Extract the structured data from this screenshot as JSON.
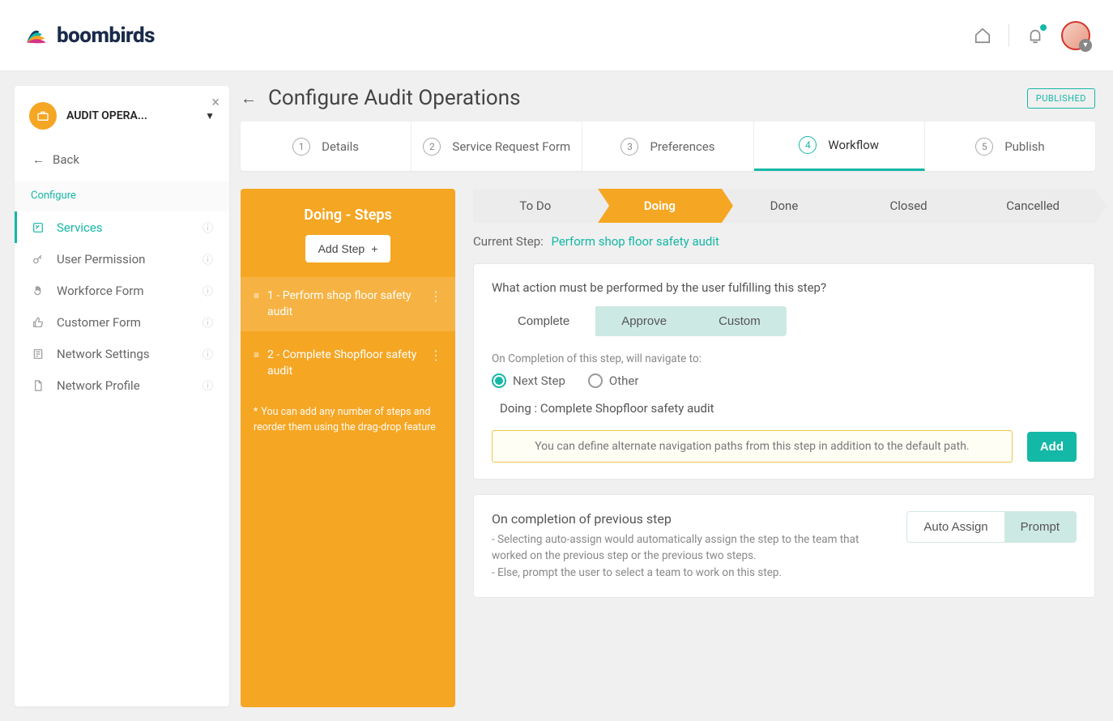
{
  "brand": "boombirds",
  "page": {
    "title": "Configure Audit Operations",
    "badge": "PUBLISHED"
  },
  "sidebar": {
    "header": "AUDIT OPERA...",
    "back": "Back",
    "section": "Configure",
    "items": [
      {
        "label": "Services",
        "active": true
      },
      {
        "label": "User Permission",
        "active": false
      },
      {
        "label": "Workforce Form",
        "active": false
      },
      {
        "label": "Customer Form",
        "active": false
      },
      {
        "label": "Network Settings",
        "active": false
      },
      {
        "label": "Network Profile",
        "active": false
      }
    ]
  },
  "tabs": [
    {
      "num": "1",
      "label": "Details"
    },
    {
      "num": "2",
      "label": "Service Request Form"
    },
    {
      "num": "3",
      "label": "Preferences"
    },
    {
      "num": "4",
      "label": "Workflow"
    },
    {
      "num": "5",
      "label": "Publish"
    }
  ],
  "steps_panel": {
    "title": "Doing - Steps",
    "add_button": "Add Step",
    "steps": [
      {
        "label": "1 - Perform shop floor safety audit"
      },
      {
        "label": "2 - Complete Shopfloor safety audit"
      }
    ],
    "hint": "You can add any number of steps and reorder them using the drag-drop feature"
  },
  "stages": [
    {
      "label": "To Do"
    },
    {
      "label": "Doing"
    },
    {
      "label": "Done"
    },
    {
      "label": "Closed"
    },
    {
      "label": "Cancelled"
    }
  ],
  "current_step": {
    "prefix": "Current Step:",
    "name": "Perform shop floor safety audit"
  },
  "action_card": {
    "question": "What action must be performed by the user fulfilling this step?",
    "options": {
      "complete": "Complete",
      "approve": "Approve",
      "custom": "Custom"
    },
    "completion_label": "On Completion of this step, will navigate to:",
    "radio": {
      "next": "Next Step",
      "other": "Other"
    },
    "navigate_to": "Doing : Complete Shopfloor safety audit",
    "alt_hint": "You can define alternate navigation paths from this step in addition to the default path.",
    "add": "Add"
  },
  "assign_card": {
    "title": "On completion of previous step",
    "line1": "- Selecting auto-assign would automatically assign the step to the team that worked on the previous step or the previous two steps.",
    "line2": "- Else, prompt the user to select a team to work on this step.",
    "auto": "Auto Assign",
    "prompt": "Prompt"
  }
}
